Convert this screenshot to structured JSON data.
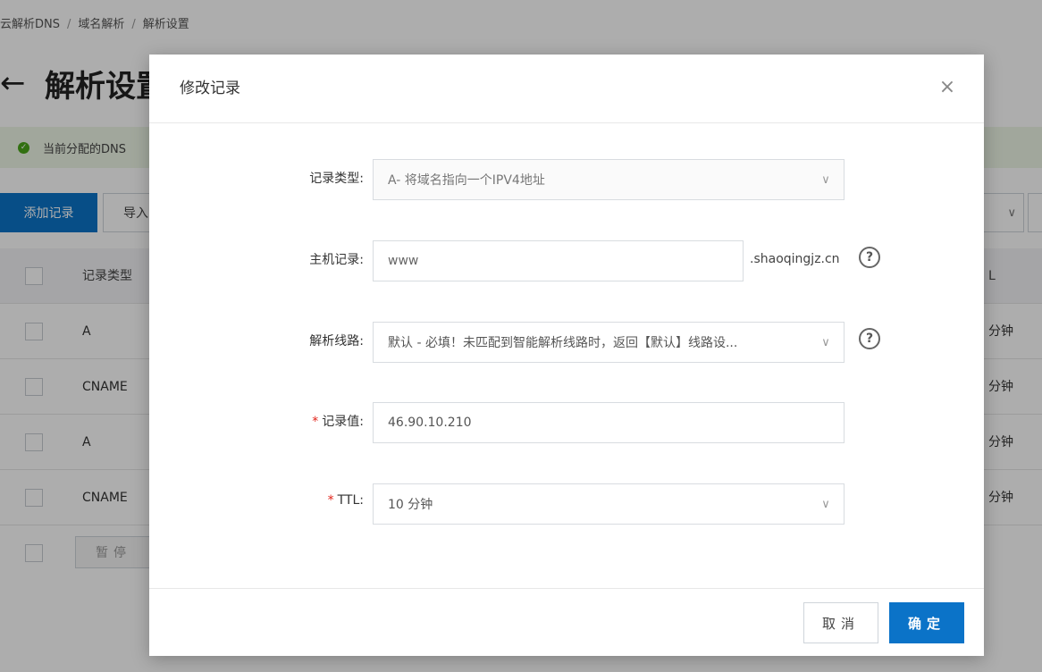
{
  "breadcrumb": [
    "云解析DNS",
    "域名解析",
    "解析设置"
  ],
  "breadcrumb_separator": "/",
  "page": {
    "back_icon": "back-arrow-icon",
    "title": "解析设置"
  },
  "notice": {
    "icon": "check-circle-icon",
    "text": "当前分配的DNS"
  },
  "toolbar": {
    "add_label": "添加记录",
    "import_label": "导入"
  },
  "table": {
    "header_type": "记录类型",
    "header_ttl": "L",
    "rows": [
      {
        "type": "A",
        "ttl": "分钟"
      },
      {
        "type": "CNAME",
        "ttl": "分钟"
      },
      {
        "type": "A",
        "ttl": "分钟"
      },
      {
        "type": "CNAME",
        "ttl": "分钟"
      }
    ],
    "pause_label": "暂停"
  },
  "modal": {
    "title": "修改记录",
    "close_icon": "close-icon",
    "fields": {
      "record_type": {
        "label": "记录类型:",
        "value": "A- 将域名指向一个IPV4地址"
      },
      "host": {
        "label": "主机记录:",
        "value": "www",
        "suffix": ".shaoqingjz.cn"
      },
      "line": {
        "label": "解析线路:",
        "value": "默认 - 必填！未匹配到智能解析线路时，返回【默认】线路设..."
      },
      "record_value": {
        "required_mark": "*",
        "label": "记录值:",
        "value": "46.90.10.210"
      },
      "ttl": {
        "required_mark": "*",
        "label": "TTL:",
        "value": "10 分钟"
      }
    },
    "cancel_label": "取消",
    "ok_label": "确定"
  },
  "colors": {
    "primary": "#0b73c8",
    "required": "#e2231a",
    "success": "#4aa61a",
    "notice_bg": "#eef7e6"
  }
}
